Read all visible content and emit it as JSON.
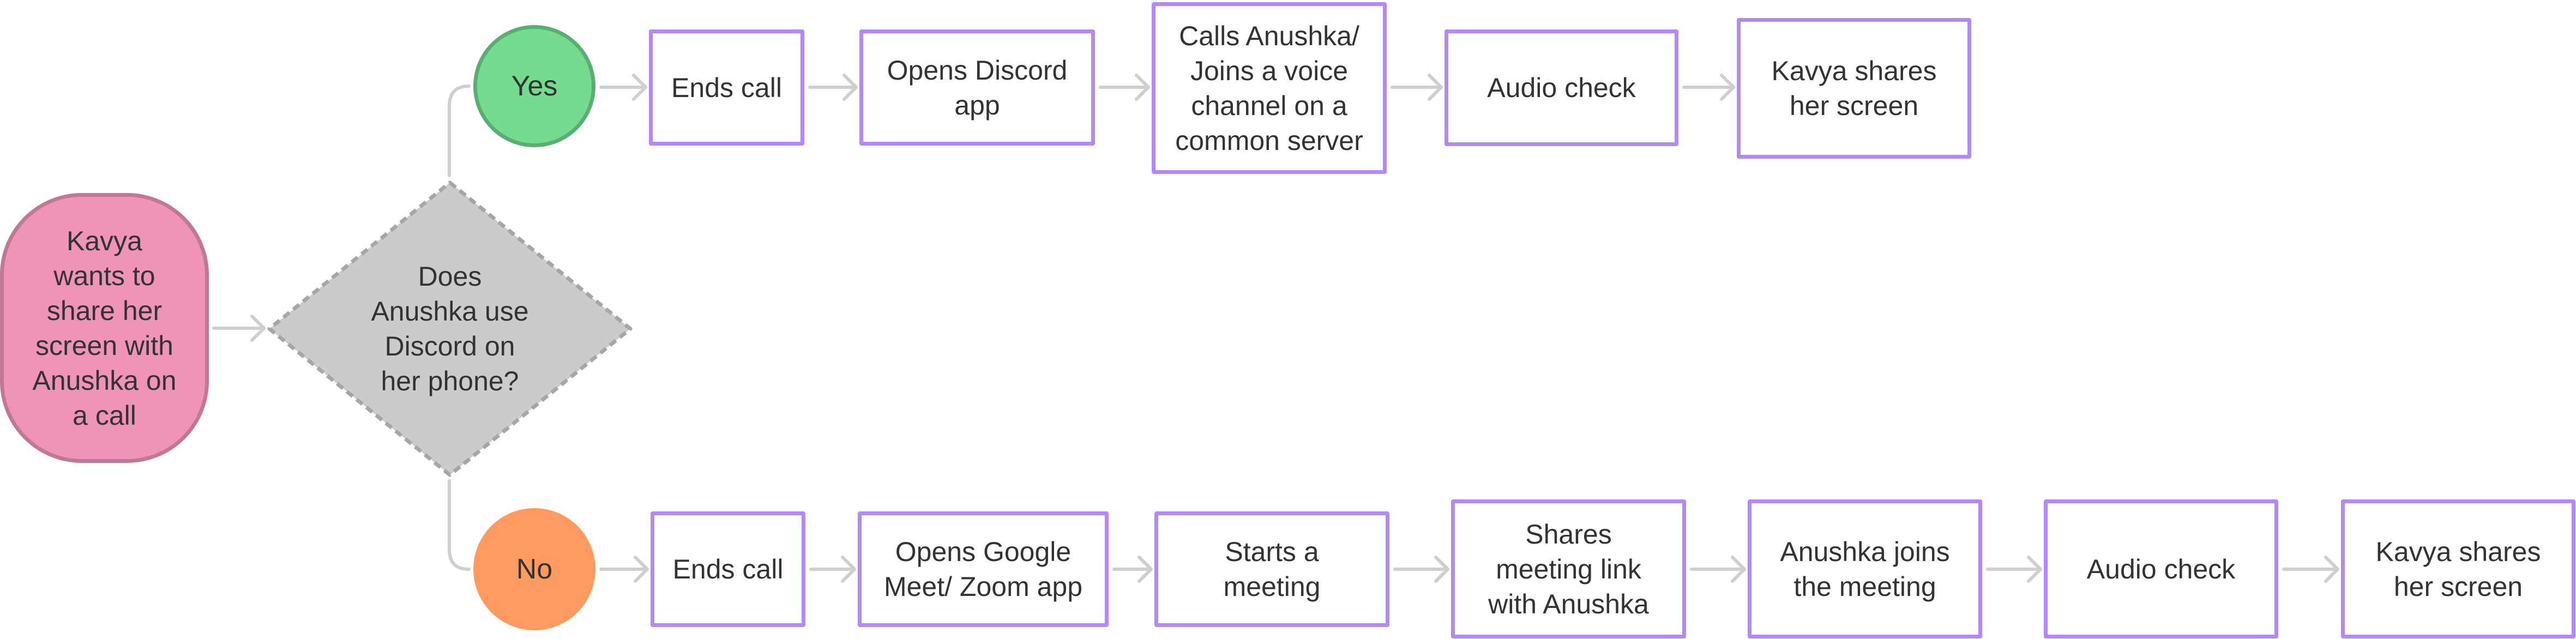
{
  "diagram": {
    "start": {
      "label": "Kavya\nwants to\nshare her\nscreen with\nAnushka on\na call"
    },
    "decision": {
      "label": "Does\nAnushka use\nDiscord on\nher phone?"
    },
    "branches": {
      "yes": {
        "label": "Yes",
        "steps": [
          {
            "label": "Ends call"
          },
          {
            "label": "Opens Discord\napp"
          },
          {
            "label": "Calls Anushka/\nJoins a voice\nchannel on a\ncommon server"
          },
          {
            "label": "Audio check"
          },
          {
            "label": "Kavya shares\nher screen"
          }
        ]
      },
      "no": {
        "label": "No",
        "steps": [
          {
            "label": "Ends call"
          },
          {
            "label": "Opens Google\nMeet/ Zoom app"
          },
          {
            "label": "Starts a\nmeeting"
          },
          {
            "label": "Shares\nmeeting link\nwith Anushka"
          },
          {
            "label": "Anushka joins\nthe meeting"
          },
          {
            "label": "Audio check"
          },
          {
            "label": "Kavya shares\nher screen"
          }
        ]
      }
    },
    "colors": {
      "start_fill": "#EF93B9",
      "start_border": "#C07896",
      "decision_fill": "#CCCACB",
      "decision_border": "#A7A5A6",
      "yes_fill": "#74DB8F",
      "yes_border": "#5BAE73",
      "no_fill": "#FF9B61",
      "step_border": "#B388F9",
      "connector": "#D0CFCF",
      "text": "#333333"
    }
  }
}
